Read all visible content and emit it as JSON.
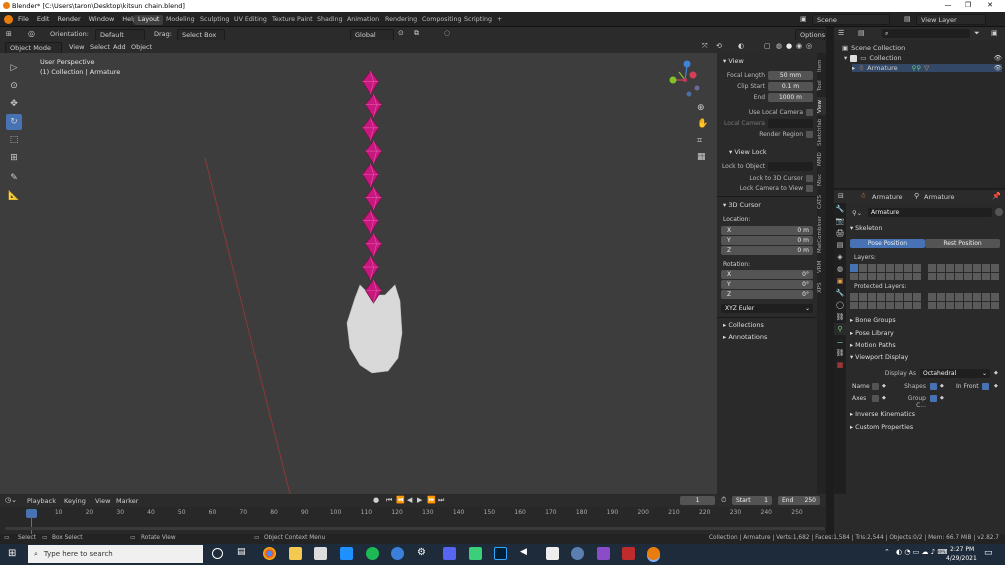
{
  "window": {
    "title": "Blender* [C:\\Users\\taron\\Desktop\\kitsun chain.blend]",
    "minimize": "—",
    "maximize": "❐",
    "close": "✕"
  },
  "menu": [
    "File",
    "Edit",
    "Render",
    "Window",
    "Help"
  ],
  "workspaces": [
    "Layout",
    "Modeling",
    "Sculpting",
    "UV Editing",
    "Texture Paint",
    "Shading",
    "Animation",
    "Rendering",
    "Compositing",
    "Scripting",
    "+"
  ],
  "active_workspace": "Layout",
  "scene": "Scene",
  "view_layer": "View Layer",
  "header": {
    "orientation_label": "Orientation:",
    "orientation_value": "Default",
    "drag_label": "Drag:",
    "drag_value": "Select Box",
    "transform_orientation": "Global",
    "options": "Options"
  },
  "header2": {
    "mode": "Object Mode",
    "items": [
      "View",
      "Select",
      "Add",
      "Object"
    ]
  },
  "viewport": {
    "title": "User Perspective",
    "subtitle": "(1) Collection | Armature",
    "gizmo": {
      "x": "X",
      "y": "Y",
      "z": "Z"
    }
  },
  "npanel": {
    "view_header": "View",
    "focal_length_label": "Focal Length",
    "focal_length": "50 mm",
    "clip_start_label": "Clip Start",
    "clip_start": "0.1 m",
    "end_label": "End",
    "clip_end": "1000 m",
    "use_local_camera": "Use Local Camera",
    "local_camera": "Local Camera",
    "render_region": "Render Region",
    "view_lock_header": "View Lock",
    "lock_to_object": "Lock to Object",
    "lock_to_3d_cursor": "Lock to 3D Cursor",
    "lock_camera_to_view": "Lock Camera to View",
    "cursor_header": "3D Cursor",
    "location_label": "Location:",
    "loc_x": "0 m",
    "loc_y": "0 m",
    "loc_z": "0 m",
    "rotation_label": "Rotation:",
    "rot_x": "0°",
    "rot_y": "0°",
    "rot_z": "0°",
    "rotation_mode": "XYZ Euler",
    "collections": "Collections",
    "annotations": "Annotations",
    "tabs": [
      "Item",
      "Tool",
      "View",
      "Sketchfab",
      "MMD",
      "Misc",
      "CATS",
      "MatCombiner",
      "VRM",
      "XPS"
    ],
    "active_tab": "View"
  },
  "outliner": {
    "root": "Scene Collection",
    "collection": "Collection",
    "armature": "Armature"
  },
  "properties": {
    "header_object": "Armature",
    "header_data": "Armature",
    "name": "Armature",
    "skeleton": "Skeleton",
    "pose_position": "Pose Position",
    "rest_position": "Rest Position",
    "layers": "Layers:",
    "protected_layers": "Protected Layers:",
    "bone_groups": "Bone Groups",
    "pose_library": "Pose Library",
    "motion_paths": "Motion Paths",
    "viewport_display": "Viewport Display",
    "display_as_label": "Display As",
    "display_as": "Octahedral",
    "name_label": "Name",
    "shapes_label": "Shapes",
    "in_front_label": "In Front",
    "axes_label": "Axes",
    "group_colors_label": "Group C...",
    "inverse_kinematics": "Inverse Kinematics",
    "custom_properties": "Custom Properties"
  },
  "timeline": {
    "menus": [
      "Playback",
      "Keying",
      "View",
      "Marker"
    ],
    "current_frame": "1",
    "start_label": "Start",
    "start": "1",
    "end_label": "End",
    "end": "250",
    "ticks": [
      "1",
      "10",
      "20",
      "30",
      "40",
      "50",
      "60",
      "70",
      "80",
      "90",
      "100",
      "110",
      "120",
      "130",
      "140",
      "150",
      "160",
      "170",
      "180",
      "190",
      "200",
      "210",
      "220",
      "230",
      "240",
      "250"
    ]
  },
  "statusbar": {
    "select": "Select",
    "box_select": "Box Select",
    "rotate_view": "Rotate View",
    "context_menu": "Object Context Menu",
    "stats": "Collection | Armature | Verts:1,682 | Faces:1,584 | Tris:2,544 | Objects:0/2 | Mem: 66.7 MiB | v2.82.7"
  },
  "taskbar": {
    "search_placeholder": "Type here to search",
    "time": "2:27 PM",
    "date": "4/29/2021"
  },
  "colors": {
    "accent": "#4772b3",
    "bone": "#c8177e",
    "mesh": "#d9d9d9",
    "axis_x": "#d43e56",
    "axis_y": "#85c126",
    "axis_z": "#3f83d9"
  }
}
